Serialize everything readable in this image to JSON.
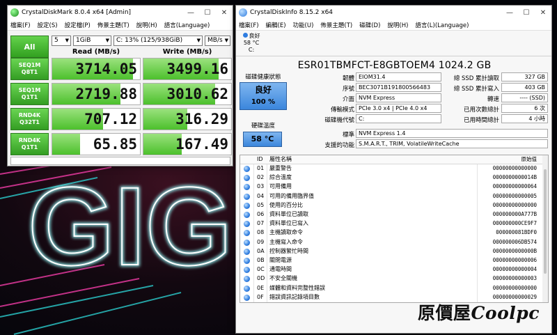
{
  "cdm": {
    "title": "CrystalDiskMark 8.0.4 x64 [Admin]",
    "menu": [
      "檔案(F)",
      "設定(S)",
      "設定檔(P)",
      "佈景主題(T)",
      "說明(H)",
      "語言(Language)"
    ],
    "all_label": "All",
    "count": "5",
    "size": "1GiB",
    "drive": "C: 13% (125/938GiB)",
    "unit": "MB/s",
    "read_header": "Read (MB/s)",
    "write_header": "Write (MB/s)",
    "rows": [
      {
        "l1": "SEQ1M",
        "l2": "Q8T1",
        "read": "3714.05",
        "write": "3499.16",
        "read_frac": 0.92,
        "write_frac": 0.86
      },
      {
        "l1": "SEQ1M",
        "l2": "Q1T1",
        "read": "2719.88",
        "write": "3010.62",
        "read_frac": 0.78,
        "write_frac": 0.82
      },
      {
        "l1": "RND4K",
        "l2": "Q32T1",
        "read": "707.12",
        "write": "316.29",
        "read_frac": 0.58,
        "write_frac": 0.5
      },
      {
        "l1": "RND4K",
        "l2": "Q1T1",
        "read": "65.85",
        "write": "167.49",
        "read_frac": 0.32,
        "write_frac": 0.44
      }
    ]
  },
  "cdi": {
    "title": "CrystalDiskInfo 8.15.2 x64",
    "menu": [
      "檔案(F)",
      "編輯(E)",
      "功能(U)",
      "佈景主題(T)",
      "磁碟(D)",
      "說明(H)",
      "語言(L)(Language)"
    ],
    "disk_tab": {
      "status": "良好",
      "temp": "58 °C",
      "letter": "C:"
    },
    "model": "ESR01TBMFCT-E8GBTOEM4 1024.2 GB",
    "health_label": "磁碟健康狀態",
    "health_status": "良好",
    "health_percent": "100 %",
    "temp_label": "硬碟溫度",
    "temp_value": "58 °C",
    "left_fields": [
      {
        "label": "韌體",
        "value": "EIOM31.4"
      },
      {
        "label": "序號",
        "value": "BEC3071B191800566483"
      },
      {
        "label": "介面",
        "value": "NVM Express"
      },
      {
        "label": "傳輸模式",
        "value": "PCIe 3.0 x4 | PCIe 4.0 x4"
      },
      {
        "label": "磁碟機代號",
        "value": "C:"
      }
    ],
    "right_fields": [
      {
        "label": "總 SSD 累計讀取",
        "value": "327 GB"
      },
      {
        "label": "總 SSD 累計寫入",
        "value": "403 GB"
      },
      {
        "label": "轉速",
        "value": "---- (SSD)"
      },
      {
        "label": "已用次數總計",
        "value": "6 次"
      },
      {
        "label": "已用時間總計",
        "value": "4 小時"
      }
    ],
    "standard_label": "標準",
    "standard_value": "NVM Express 1.4",
    "features_label": "支援的功能",
    "features_value": "S.M.A.R.T., TRIM, VolatileWriteCache",
    "smart_headers": {
      "id": "ID",
      "name": "屬性名稱",
      "raw": "原始值"
    },
    "smart": [
      {
        "id": "01",
        "name": "嚴重警告",
        "raw": "00000000000000"
      },
      {
        "id": "02",
        "name": "綜合溫度",
        "raw": "0000000000014B"
      },
      {
        "id": "03",
        "name": "可用備用",
        "raw": "00000000000064"
      },
      {
        "id": "04",
        "name": "可用的備用臨界值",
        "raw": "00000000000005"
      },
      {
        "id": "05",
        "name": "使用的百分比",
        "raw": "00000000000000"
      },
      {
        "id": "06",
        "name": "資料單位已讀取",
        "raw": "000000000A777B"
      },
      {
        "id": "07",
        "name": "資料單位已寫入",
        "raw": "000000000CE9F7"
      },
      {
        "id": "08",
        "name": "主機讀取命令",
        "raw": "000000081BDF0"
      },
      {
        "id": "09",
        "name": "主機寫入命令",
        "raw": "000000006DB574"
      },
      {
        "id": "0A",
        "name": "控制器繁忙時間",
        "raw": "0000000000000B"
      },
      {
        "id": "0B",
        "name": "關閉電源",
        "raw": "00000000000006"
      },
      {
        "id": "0C",
        "name": "通電時間",
        "raw": "00000000000004"
      },
      {
        "id": "0D",
        "name": "不安全關機",
        "raw": "00000000000003"
      },
      {
        "id": "0E",
        "name": "媒體和資料完整性錯誤",
        "raw": "00000000000000"
      },
      {
        "id": "0F",
        "name": "錯誤資訊記錄項目數",
        "raw": "00000000000029"
      }
    ]
  },
  "background_text": "GIG",
  "watermark": {
    "cn": "原價屋",
    "en": "Coolpc"
  }
}
